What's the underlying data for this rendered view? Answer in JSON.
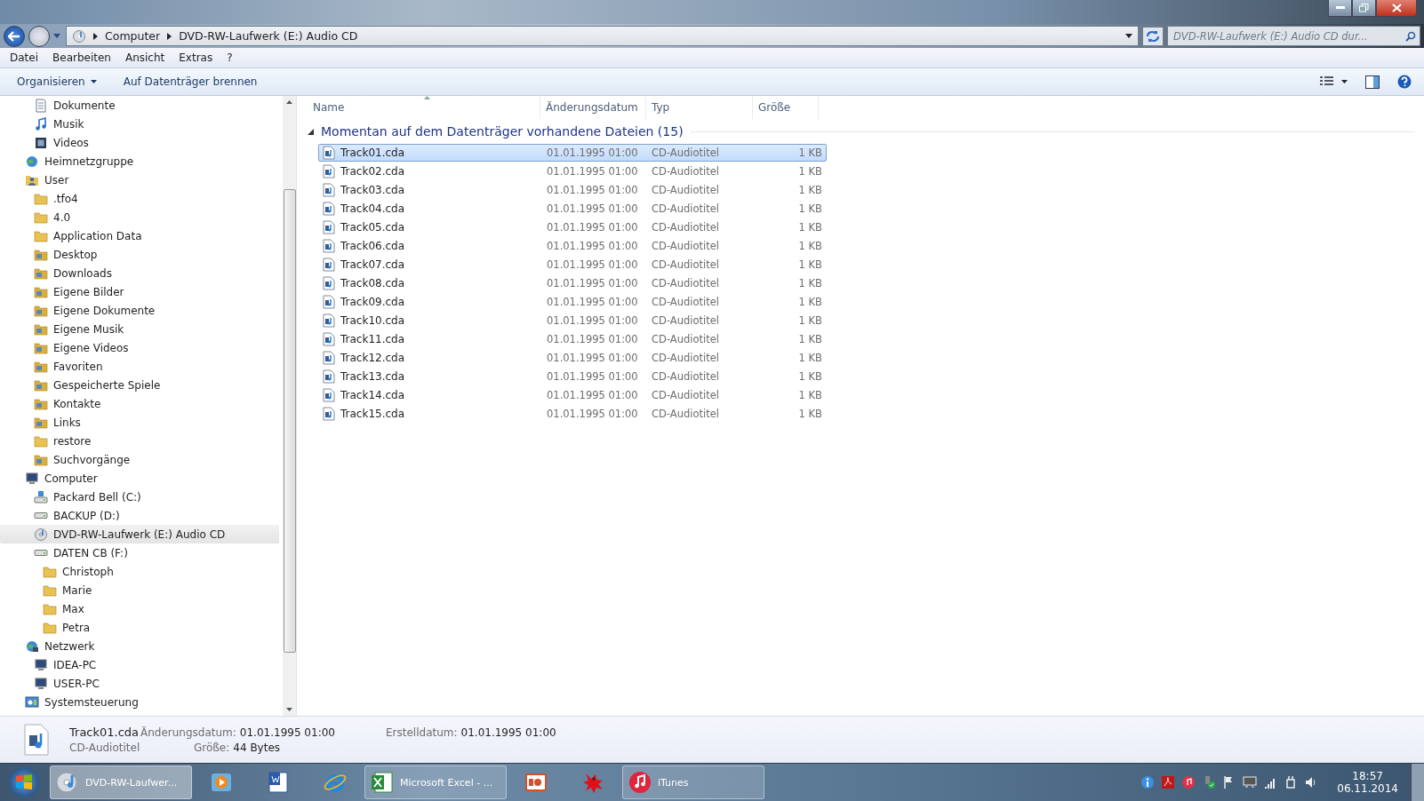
{
  "address": {
    "crumbs": [
      "Computer",
      "DVD-RW-Laufwerk (E:) Audio CD"
    ]
  },
  "search": {
    "placeholder": "DVD-RW-Laufwerk (E:) Audio CD dur..."
  },
  "menu": [
    "Datei",
    "Bearbeiten",
    "Ansicht",
    "Extras",
    "?"
  ],
  "toolbar": [
    {
      "label": "Organisieren",
      "dropdown": true
    },
    {
      "label": "Auf Datenträger brennen",
      "dropdown": false
    }
  ],
  "sidebar": {
    "partial_items": [
      {
        "label": "Dokumente",
        "kind": "doclib",
        "selected": false
      },
      {
        "label": "Musik",
        "kind": "musiclib",
        "selected": false
      },
      {
        "label": "Videos",
        "kind": "videolib",
        "selected": false
      }
    ],
    "tree": [
      {
        "label": "Heimnetzgruppe",
        "kind": "homegroup",
        "selected": false
      },
      {
        "label": "User",
        "kind": "user",
        "selected": false,
        "children": [
          {
            "label": ".tfo4",
            "kind": "folder",
            "selected": false
          },
          {
            "label": "4.0",
            "kind": "folder",
            "selected": false
          },
          {
            "label": "Application Data",
            "kind": "folder",
            "selected": false
          },
          {
            "label": "Desktop",
            "kind": "specialfolder",
            "selected": false
          },
          {
            "label": "Downloads",
            "kind": "specialfolder",
            "selected": false
          },
          {
            "label": "Eigene Bilder",
            "kind": "specialfolder",
            "selected": false
          },
          {
            "label": "Eigene Dokumente",
            "kind": "specialfolder",
            "selected": false
          },
          {
            "label": "Eigene Musik",
            "kind": "specialfolder",
            "selected": false
          },
          {
            "label": "Eigene Videos",
            "kind": "specialfolder",
            "selected": false
          },
          {
            "label": "Favoriten",
            "kind": "specialfolder",
            "selected": false
          },
          {
            "label": "Gespeicherte Spiele",
            "kind": "specialfolder",
            "selected": false
          },
          {
            "label": "Kontakte",
            "kind": "specialfolder",
            "selected": false
          },
          {
            "label": "Links",
            "kind": "specialfolder",
            "selected": false
          },
          {
            "label": "restore",
            "kind": "folder",
            "selected": false
          },
          {
            "label": "Suchvorgänge",
            "kind": "specialfolder",
            "selected": false
          }
        ]
      },
      {
        "label": "Computer",
        "kind": "computer",
        "selected": false,
        "children": [
          {
            "label": "Packard Bell (C:)",
            "kind": "systemdrive",
            "selected": false
          },
          {
            "label": "BACKUP (D:)",
            "kind": "drive",
            "selected": false
          },
          {
            "label": "DVD-RW-Laufwerk (E:) Audio CD",
            "kind": "cd",
            "selected": true
          },
          {
            "label": "DATEN CB (F:)",
            "kind": "drive",
            "selected": false,
            "children": [
              {
                "label": "Christoph",
                "kind": "folder",
                "selected": false
              },
              {
                "label": "Marie",
                "kind": "folder",
                "selected": false
              },
              {
                "label": "Max",
                "kind": "folder",
                "selected": false
              },
              {
                "label": "Petra",
                "kind": "folder",
                "selected": false
              }
            ]
          }
        ]
      },
      {
        "label": "Netzwerk",
        "kind": "network",
        "selected": false,
        "children": [
          {
            "label": "IDEA-PC",
            "kind": "pc",
            "selected": false
          },
          {
            "label": "USER-PC",
            "kind": "pc",
            "selected": false
          }
        ]
      },
      {
        "label": "Systemsteuerung",
        "kind": "controlpanel",
        "selected": false
      }
    ]
  },
  "columns": [
    {
      "label": "Name",
      "sorted": true
    },
    {
      "label": "Änderungsdatum",
      "sorted": false
    },
    {
      "label": "Typ",
      "sorted": false
    },
    {
      "label": "Größe",
      "sorted": false
    }
  ],
  "group": {
    "title": "Momentan auf dem Datenträger vorhandene Dateien (15)",
    "expanded": true
  },
  "rows": [
    {
      "name": "Track01.cda",
      "date": "01.01.1995 01:00",
      "type": "CD-Audiotitel",
      "size": "1 KB",
      "selected": true
    },
    {
      "name": "Track02.cda",
      "date": "01.01.1995 01:00",
      "type": "CD-Audiotitel",
      "size": "1 KB",
      "selected": false
    },
    {
      "name": "Track03.cda",
      "date": "01.01.1995 01:00",
      "type": "CD-Audiotitel",
      "size": "1 KB",
      "selected": false
    },
    {
      "name": "Track04.cda",
      "date": "01.01.1995 01:00",
      "type": "CD-Audiotitel",
      "size": "1 KB",
      "selected": false
    },
    {
      "name": "Track05.cda",
      "date": "01.01.1995 01:00",
      "type": "CD-Audiotitel",
      "size": "1 KB",
      "selected": false
    },
    {
      "name": "Track06.cda",
      "date": "01.01.1995 01:00",
      "type": "CD-Audiotitel",
      "size": "1 KB",
      "selected": false
    },
    {
      "name": "Track07.cda",
      "date": "01.01.1995 01:00",
      "type": "CD-Audiotitel",
      "size": "1 KB",
      "selected": false
    },
    {
      "name": "Track08.cda",
      "date": "01.01.1995 01:00",
      "type": "CD-Audiotitel",
      "size": "1 KB",
      "selected": false
    },
    {
      "name": "Track09.cda",
      "date": "01.01.1995 01:00",
      "type": "CD-Audiotitel",
      "size": "1 KB",
      "selected": false
    },
    {
      "name": "Track10.cda",
      "date": "01.01.1995 01:00",
      "type": "CD-Audiotitel",
      "size": "1 KB",
      "selected": false
    },
    {
      "name": "Track11.cda",
      "date": "01.01.1995 01:00",
      "type": "CD-Audiotitel",
      "size": "1 KB",
      "selected": false
    },
    {
      "name": "Track12.cda",
      "date": "01.01.1995 01:00",
      "type": "CD-Audiotitel",
      "size": "1 KB",
      "selected": false
    },
    {
      "name": "Track13.cda",
      "date": "01.01.1995 01:00",
      "type": "CD-Audiotitel",
      "size": "1 KB",
      "selected": false
    },
    {
      "name": "Track14.cda",
      "date": "01.01.1995 01:00",
      "type": "CD-Audiotitel",
      "size": "1 KB",
      "selected": false
    },
    {
      "name": "Track15.cda",
      "date": "01.01.1995 01:00",
      "type": "CD-Audiotitel",
      "size": "1 KB",
      "selected": false
    }
  ],
  "details": {
    "name": "Track01.cda",
    "type": "CD-Audiotitel",
    "fields": [
      {
        "label": "Änderungsdatum:",
        "value": "01.01.1995 01:00"
      },
      {
        "label": "Größe:",
        "value": "44 Bytes"
      },
      {
        "label": "Erstelldatum:",
        "value": "01.01.1995 01:00"
      }
    ]
  },
  "taskbar": [
    {
      "kind": "explorer",
      "label": "DVD-RW-Laufwer...",
      "selected": true
    },
    {
      "kind": "media",
      "selected": false
    },
    {
      "kind": "word",
      "selected": false
    },
    {
      "kind": "ie",
      "selected": false
    },
    {
      "kind": "excel",
      "label": "Microsoft Excel - ...",
      "selected": false
    },
    {
      "kind": "powerpoint",
      "selected": false
    },
    {
      "kind": "figure",
      "selected": false
    },
    {
      "kind": "itunes",
      "label": "iTunes",
      "selected": false
    }
  ],
  "clock": {
    "time": "18:57",
    "date": "06.11.2014"
  }
}
